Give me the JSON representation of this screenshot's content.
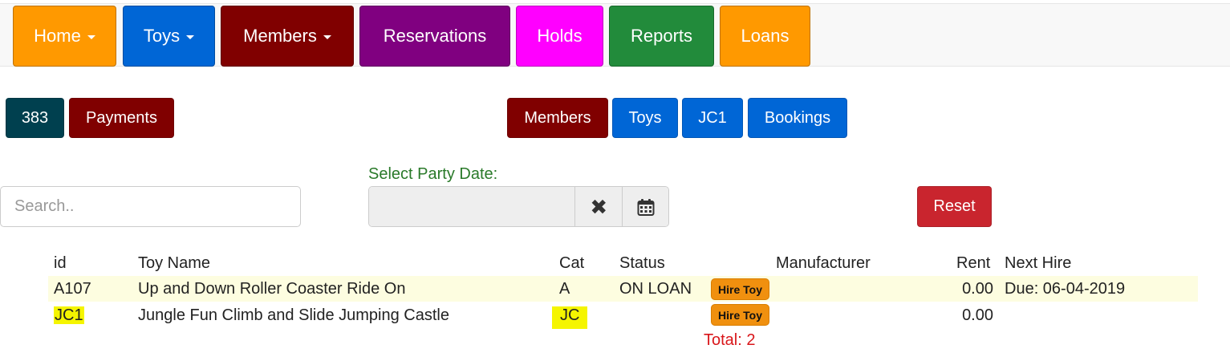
{
  "nav": {
    "home": "Home",
    "toys": "Toys",
    "members": "Members",
    "reservations": "Reservations",
    "holds": "Holds",
    "reports": "Reports",
    "loans": "Loans"
  },
  "toolbar": {
    "member_id": "383",
    "payments": "Payments",
    "members": "Members",
    "toys": "Toys",
    "toy_id": "JC1",
    "bookings": "Bookings"
  },
  "search": {
    "placeholder": "Search.."
  },
  "party_date": {
    "label": "Select Party Date:",
    "value": ""
  },
  "reset_label": "Reset",
  "table": {
    "headers": {
      "id": "id",
      "toy_name": "Toy Name",
      "cat": "Cat",
      "status": "Status",
      "manufacturer": "Manufacturer",
      "rent": "Rent",
      "next_hire": "Next Hire"
    },
    "rows": [
      {
        "id": "A107",
        "toy_name": "Up and Down Roller Coaster Ride On",
        "cat": "A",
        "status": "ON LOAN",
        "action": "Hire Toy",
        "manufacturer": "",
        "rent": "0.00",
        "next_hire": "Due: 06-04-2019"
      },
      {
        "id": "JC1",
        "toy_name": "Jungle Fun Climb and Slide Jumping Castle",
        "cat": "JC",
        "status": "",
        "action": "Hire Toy",
        "manufacturer": "",
        "rent": "0.00",
        "next_hire": ""
      }
    ],
    "total": "Total: 2"
  },
  "colors": {
    "orange": "#ff9900",
    "blue": "#0066d6",
    "maroon": "#800000",
    "purple": "#800080",
    "magenta": "#ff00ff",
    "green": "#228b3b",
    "teal": "#00404f",
    "red": "#c9252e"
  },
  "icons": {
    "clear": "close-icon",
    "calendar": "calendar-icon",
    "caret": "caret-down-icon"
  }
}
